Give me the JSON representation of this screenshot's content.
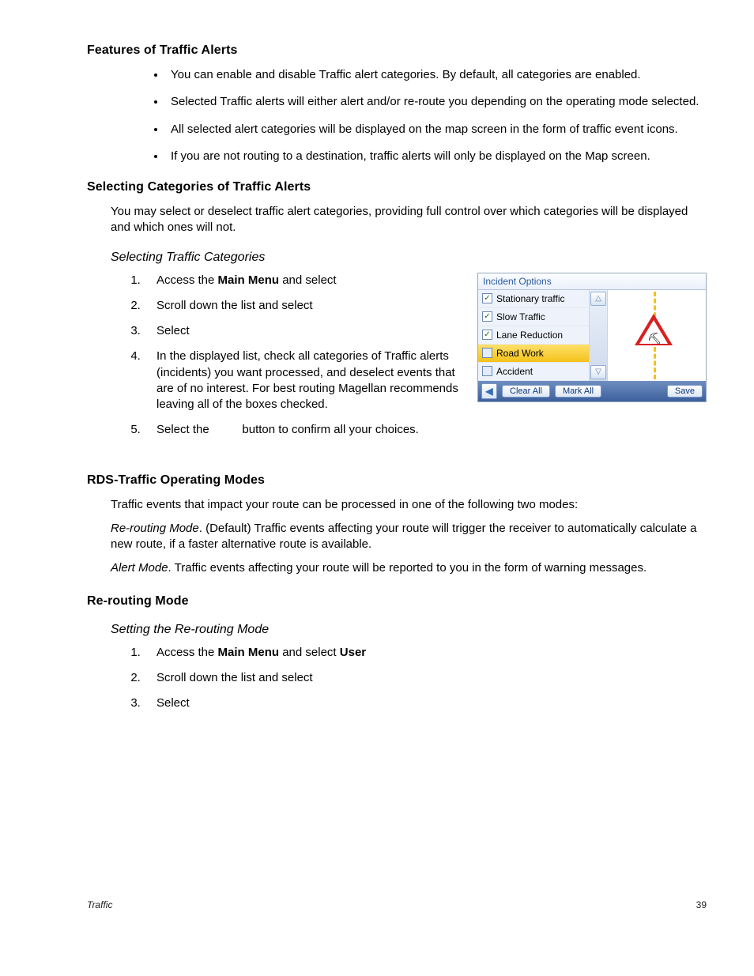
{
  "headings": {
    "features": "Features of Traffic Alerts",
    "selecting_categories": "Selecting Categories of Traffic Alerts",
    "selecting_traffic_categories": "Selecting Traffic Categories",
    "operating_modes": "RDS-Traffic Operating Modes",
    "rerouting_mode": "Re-routing Mode",
    "setting_rerouting": "Setting the Re-routing Mode"
  },
  "features_bullets": [
    "You can enable and disable Traffic alert categories. By default, all categories are enabled.",
    "Selected Traffic alerts will either alert and/or re-route you depending on the operating mode selected.",
    "All selected alert categories will be displayed on the map screen in the form of traffic event icons.",
    "If you are not routing to a destination, traffic alerts will only be displayed on the Map screen."
  ],
  "selecting_intro": "You may select or deselect traffic alert categories, providing full control over which categories will be displayed and which ones will not.",
  "steps1": {
    "s1_prefix": "Access the ",
    "s1_bold": "Main Menu",
    "s1_suffix": " and select",
    "s2": "Scroll down the list and select",
    "s3": "Select",
    "s4": "In the displayed list, check all categories of Traffic alerts (incidents) you want processed, and deselect events that are of no interest. For best routing Magellan recommends leaving all of the boxes checked.",
    "s5_prefix": "Select the ",
    "s5_suffix": " button to confirm all your choices."
  },
  "operating_intro": "Traffic events that impact your route can be processed in one of the following two modes:",
  "rerouting_desc": {
    "label": "Re-routing Mode",
    "text": ". (Default)  Traffic events affecting your route will trigger the receiver to automatically calculate a new route, if a faster alternative route is available."
  },
  "alert_desc": {
    "label": "Alert Mode",
    "text": ". Traffic events affecting your route will be reported to you in the form of warning messages."
  },
  "steps2": {
    "s1_prefix": "Access the ",
    "s1_bold1": "Main Menu",
    "s1_mid": " and select ",
    "s1_bold2": "User",
    "s2": "Scroll down the list and select",
    "s3": "Select"
  },
  "incident_panel": {
    "title": "Incident Options",
    "items": [
      {
        "label": "Stationary traffic",
        "checked": true,
        "selected": false
      },
      {
        "label": "Slow Traffic",
        "checked": true,
        "selected": false
      },
      {
        "label": "Lane Reduction",
        "checked": true,
        "selected": false
      },
      {
        "label": "Road Work",
        "checked": false,
        "selected": true
      },
      {
        "label": "Accident",
        "checked": false,
        "selected": false
      }
    ],
    "buttons": {
      "clear_all": "Clear All",
      "mark_all": "Mark All",
      "save": "Save"
    }
  },
  "footer": {
    "section": "Traffic",
    "page": "39"
  }
}
